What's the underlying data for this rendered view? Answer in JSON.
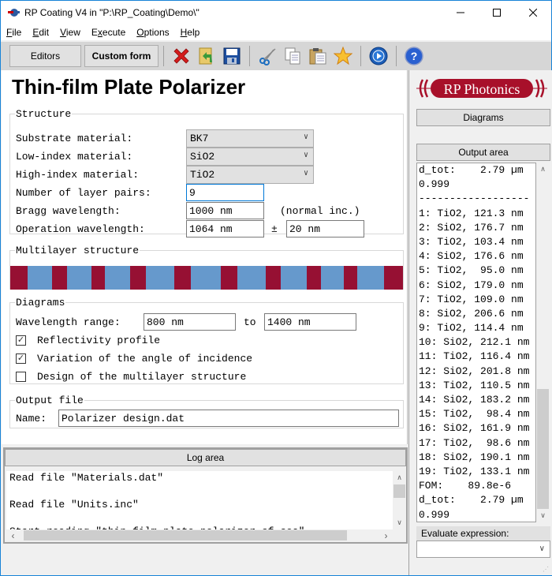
{
  "window": {
    "title": "RP Coating V4 in \"P:\\RP_Coating\\Demo\\\"",
    "minimize_label": "—",
    "maximize_label": "☐",
    "close_label": "✕"
  },
  "menu": {
    "items": [
      {
        "label": "File",
        "accel": "F",
        "rest": "ile"
      },
      {
        "label": "Edit",
        "accel": "E",
        "rest": "dit"
      },
      {
        "label": "View",
        "accel": "V",
        "rest": "iew"
      },
      {
        "label": "Execute",
        "accel": "x",
        "pre": "E",
        "rest": "ecute"
      },
      {
        "label": "Options",
        "accel": "O",
        "rest": "ptions"
      },
      {
        "label": "Help",
        "accel": "H",
        "rest": "elp"
      }
    ]
  },
  "toolbar": {
    "editors_label": "Editors",
    "custom_form_label": "Custom form",
    "icons": [
      "close-file-icon",
      "open-file-icon",
      "save-icon",
      "cut-icon",
      "copy-icon",
      "paste-icon",
      "favorite-star-icon",
      "run-icon",
      "help-icon"
    ]
  },
  "form": {
    "title": "Thin-film Plate Polarizer",
    "structure": {
      "legend": "Structure",
      "substrate_label": "Substrate material:",
      "substrate_value": "BK7",
      "low_index_label": "Low-index material:",
      "low_index_value": "SiO2",
      "high_index_label": "High-index material:",
      "high_index_value": "TiO2",
      "layer_pairs_label": "Number of layer pairs:",
      "layer_pairs_value": "9",
      "bragg_label": "Bragg wavelength:",
      "bragg_value": "1000 nm",
      "bragg_note": "(normal inc.)",
      "operation_label": "Operation wavelength:",
      "operation_value": "1064 nm",
      "plusminus": "±",
      "tolerance_value": "20 nm"
    },
    "multilayer": {
      "legend": "Multilayer structure",
      "high_color": "#961033",
      "low_color": "#6699cc",
      "layers": [
        {
          "material": "TiO2",
          "thickness": 121.3
        },
        {
          "material": "SiO2",
          "thickness": 176.7
        },
        {
          "material": "TiO2",
          "thickness": 103.4
        },
        {
          "material": "SiO2",
          "thickness": 176.6
        },
        {
          "material": "TiO2",
          "thickness": 95.0
        },
        {
          "material": "SiO2",
          "thickness": 179.0
        },
        {
          "material": "TiO2",
          "thickness": 109.0
        },
        {
          "material": "SiO2",
          "thickness": 206.6
        },
        {
          "material": "TiO2",
          "thickness": 114.4
        },
        {
          "material": "SiO2",
          "thickness": 212.1
        },
        {
          "material": "TiO2",
          "thickness": 116.4
        },
        {
          "material": "SiO2",
          "thickness": 201.8
        },
        {
          "material": "TiO2",
          "thickness": 110.5
        },
        {
          "material": "SiO2",
          "thickness": 183.2
        },
        {
          "material": "TiO2",
          "thickness": 98.4
        },
        {
          "material": "SiO2",
          "thickness": 161.9
        },
        {
          "material": "TiO2",
          "thickness": 98.6
        },
        {
          "material": "SiO2",
          "thickness": 190.1
        },
        {
          "material": "TiO2",
          "thickness": 133.1
        }
      ]
    },
    "diagrams": {
      "legend": "Diagrams",
      "range_label": "Wavelength range:",
      "range_from": "800 nm",
      "range_to_label": "to",
      "range_to": "1400 nm",
      "options": [
        {
          "label": "Reflectivity profile",
          "checked": true
        },
        {
          "label": "Variation of the angle of incidence",
          "checked": true
        },
        {
          "label": "Design of the multilayer structure",
          "checked": false
        }
      ]
    },
    "output_file": {
      "legend": "Output file",
      "name_label": "Name:",
      "name_value": "Polarizer design.dat"
    }
  },
  "log": {
    "header": "Log area",
    "lines": [
      "Read file \"Materials.dat\"",
      "",
      "Read file \"Units.inc\"",
      "",
      "Start reading \"thin-film plate polarizer.cf.coa\""
    ]
  },
  "right": {
    "logo_text": "RP Photonics",
    "diagrams_label": "Diagrams",
    "output_header": "Output area",
    "output_lines": [
      "d_tot:    2.79 µm",
      "0.999",
      "------------------",
      "1: TiO2, 121.3 nm",
      "2: SiO2, 176.7 nm",
      "3: TiO2, 103.4 nm",
      "4: SiO2, 176.6 nm",
      "5: TiO2,  95.0 nm",
      "6: SiO2, 179.0 nm",
      "7: TiO2, 109.0 nm",
      "8: SiO2, 206.6 nm",
      "9: TiO2, 114.4 nm",
      "10: SiO2, 212.1 nm",
      "11: TiO2, 116.4 nm",
      "12: SiO2, 201.8 nm",
      "13: TiO2, 110.5 nm",
      "14: SiO2, 183.2 nm",
      "15: TiO2,  98.4 nm",
      "16: SiO2, 161.9 nm",
      "17: TiO2,  98.6 nm",
      "18: SiO2, 190.1 nm",
      "19: TiO2, 133.1 nm",
      "FOM:    89.8e-6",
      "d_tot:    2.79 µm",
      "0.999"
    ],
    "evaluate_label": "Evaluate expression:",
    "evaluate_value": ""
  }
}
